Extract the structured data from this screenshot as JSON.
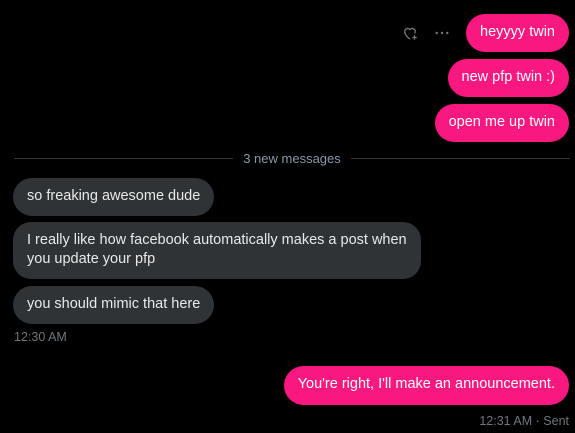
{
  "messages_sent_top": [
    {
      "text": "heyyyy twin"
    },
    {
      "text": "new pfp twin :)"
    },
    {
      "text": "open me up twin"
    }
  ],
  "divider": {
    "label": "3 new messages"
  },
  "messages_received": [
    {
      "text": "so freaking awesome dude"
    },
    {
      "text": "I really like how facebook automatically makes a post when you update your pfp"
    },
    {
      "text": "you should mimic that here"
    }
  ],
  "received_timestamp": "12:30 AM",
  "message_sent_bottom": {
    "text": "You're right, I'll make an announcement."
  },
  "sent_status": {
    "time": "12:31 AM",
    "separator": "·",
    "status": "Sent"
  },
  "actions": {
    "react_icon": "heart-plus-icon",
    "more_icon": "more-icon"
  },
  "colors": {
    "background": "#000000",
    "sent_bubble": "#f91880",
    "received_bubble": "#2f3336",
    "muted_text": "#71767b"
  }
}
